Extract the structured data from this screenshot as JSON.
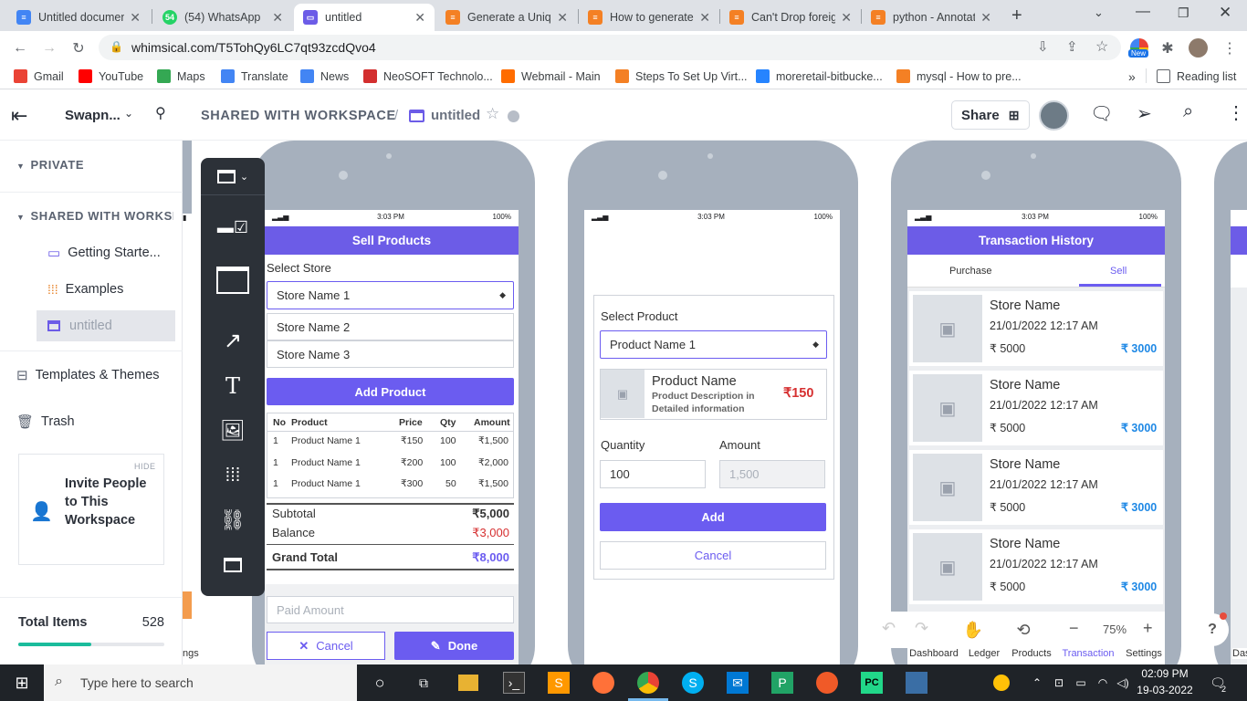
{
  "browser": {
    "tabs": [
      {
        "title": "Untitled documen",
        "color": "#4285f4"
      },
      {
        "title": "(54) WhatsApp",
        "color": "#25d366"
      },
      {
        "title": "untitled",
        "color": "#6c5ce7"
      },
      {
        "title": "Generate a Uniqu",
        "color": "#f48024"
      },
      {
        "title": "How to generate",
        "color": "#f48024"
      },
      {
        "title": "Can't Drop foreig",
        "color": "#f48024"
      },
      {
        "title": "python - Annotat",
        "color": "#f48024"
      }
    ],
    "new_tab": "+",
    "url": "whimsical.com/T5TohQy6LC7qt93zcdQvo4",
    "profile_badge": "New",
    "bookmarks": [
      {
        "label": "Gmail",
        "color": "#ea4335"
      },
      {
        "label": "YouTube",
        "color": "#ff0000"
      },
      {
        "label": "Maps",
        "color": "#34a853"
      },
      {
        "label": "Translate",
        "color": "#4285f4"
      },
      {
        "label": "News",
        "color": "#4285f4"
      },
      {
        "label": "NeoSOFT Technolo...",
        "color": "#d32f2f"
      },
      {
        "label": "Webmail - Main",
        "color": "#ff6c00"
      },
      {
        "label": "Steps To Set Up Virt...",
        "color": "#f48024"
      },
      {
        "label": "moreretail-bitbucke...",
        "color": "#2684ff"
      },
      {
        "label": "mysql - How to pre...",
        "color": "#f48024"
      }
    ],
    "more_bookmarks": "»",
    "reading_list": "Reading list"
  },
  "app": {
    "workspace": "Swapn...",
    "breadcrumb_shared": "SHARED WITH WORKSPACE",
    "breadcrumb_sep": "/",
    "board_title": "untitled",
    "share_label": "Share"
  },
  "sidebar": {
    "private": "PRIVATE",
    "shared": "SHARED WITH WORKSPACE",
    "items": [
      "Getting Starte...",
      "Examples",
      "untitled"
    ],
    "templates": "Templates & Themes",
    "trash": "Trash",
    "invite_hide": "HIDE",
    "invite_text": "Invite People to This Workspace",
    "total_items_label": "Total Items",
    "total_items_value": "528",
    "usage_fraction": 0.5
  },
  "phones": {
    "status_time": "3:03 PM",
    "battery": "100%",
    "sell": {
      "title": "Sell Products",
      "select_store_label": "Select Store",
      "selected_store": "Store Name 1",
      "store_options": [
        "Store Name 2",
        "Store Name 3"
      ],
      "add_product": "Add Product",
      "headers": [
        "No",
        "Product",
        "Price",
        "Qty",
        "Amount"
      ],
      "rows": [
        [
          "1",
          "Product Name 1",
          "₹150",
          "100",
          "₹1,500"
        ],
        [
          "1",
          "Product Name 1",
          "₹200",
          "100",
          "₹2,000"
        ],
        [
          "1",
          "Product Name 1",
          "₹300",
          "50",
          "₹1,500"
        ]
      ],
      "subtotal_label": "Subtotal",
      "subtotal_value": "₹5,000",
      "balance_label": "Balance",
      "balance_value": "₹3,000",
      "grand_total_label": "Grand Total",
      "grand_total_value": "₹8,000",
      "paid_placeholder": "Paid Amount",
      "cancel": "Cancel",
      "done": "Done"
    },
    "add": {
      "select_product_label": "Select Product",
      "selected_product": "Product Name 1",
      "product_name": "Product Name",
      "product_desc": "Product Description in Detailed information",
      "product_price": "₹150",
      "quantity_label": "Quantity",
      "amount_label": "Amount",
      "quantity_value": "100",
      "amount_value": "1,500",
      "add": "Add",
      "cancel": "Cancel"
    },
    "history": {
      "title": "Transaction History",
      "tabs": [
        "Purchase",
        "Sell"
      ],
      "entries": [
        {
          "store": "Store Name",
          "date": "21/01/2022 12:17 AM",
          "amount": "₹ 5000",
          "paid": "₹ 3000"
        },
        {
          "store": "Store Name",
          "date": "21/01/2022 12:17 AM",
          "amount": "₹ 5000",
          "paid": "₹ 3000"
        },
        {
          "store": "Store Name",
          "date": "21/01/2022 12:17 AM",
          "amount": "₹ 5000",
          "paid": "₹ 3000"
        },
        {
          "store": "Store Name",
          "date": "21/01/2022 12:17 AM",
          "amount": "₹ 5000",
          "paid": "₹ 3000"
        }
      ],
      "nav": [
        "Dashboard",
        "Ledger",
        "Products",
        "Transaction",
        "Settings"
      ]
    },
    "left_partial": "ngs",
    "right_partial": "Das"
  },
  "zoom": {
    "minus": "−",
    "level": "75%",
    "plus": "+",
    "help": "?"
  },
  "taskbar": {
    "search_placeholder": "Type here to search",
    "time": "02:09 PM",
    "date": "19-03-2022",
    "notifications": "2"
  },
  "colors": {
    "accent": "#6b5cf0",
    "price_red": "#d63031",
    "link_blue": "#1e88e5"
  }
}
